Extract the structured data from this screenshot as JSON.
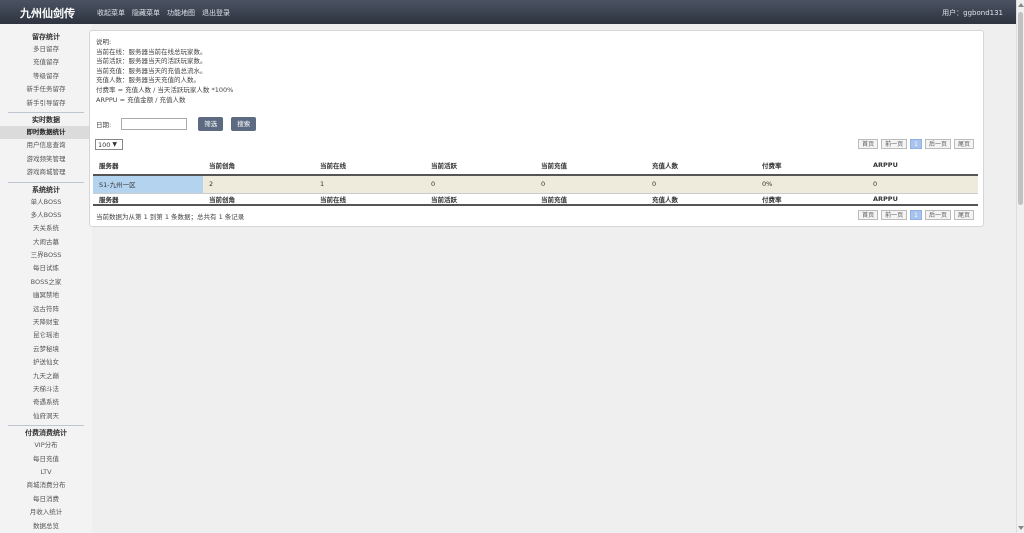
{
  "header": {
    "brand": "九州仙剑传",
    "nav": [
      "收起菜单",
      "隐藏菜单",
      "功能地图",
      "退出登录"
    ],
    "user": "用户：ggbond131"
  },
  "sidebar": {
    "group_retention": "留存统计",
    "retention_items": [
      "多日留存",
      "充值留存",
      "等级留存",
      "新手任务留存",
      "新手引导留存"
    ],
    "group_realtime": "实时数据",
    "realtime_items": [
      "即时数据统计",
      "用户信息查询",
      "游戏频笑管理",
      "游戏商城管理"
    ],
    "group_system": "系统统计",
    "system_items": [
      "单人BOSS",
      "多人BOSS",
      "天关系统",
      "大闹古墓",
      "三界BOSS",
      "每日试炼",
      "BOSS之家",
      "幽冥禁地",
      "远古符阵",
      "天降财宝",
      "昆仑瑶池",
      "云梦秘境",
      "护送仙女",
      "九天之巅",
      "天梯斗法",
      "奇遇系统",
      "仙府洞天"
    ],
    "group_pay": "付费消费统计",
    "pay_items": [
      "VIP分布",
      "每日充值",
      "LTV",
      "商城消费分布",
      "每日消费",
      "月收入统计",
      "数据总览"
    ]
  },
  "description": {
    "title": "说明:",
    "lines": [
      "当前在线：服务器当前在线总玩家数。",
      "当前活跃：服务器当天的活跃玩家数。",
      "当前充值：服务器当天的充值总流水。",
      "充值人数：服务器当天充值的人数。",
      "付费率 = 充值人数 / 当天活跃玩家人数 *100%",
      "ARPPU = 充值金额 / 充值人数"
    ]
  },
  "filter": {
    "date_label": "日期:",
    "date_value": "",
    "filter_button": "筛选",
    "search_button": "搜索"
  },
  "page_size": "100",
  "pager": {
    "first": "首页",
    "prev": "前一页",
    "current": "1",
    "next": "后一页",
    "last": "尾页"
  },
  "table": {
    "headers": [
      "服务器",
      "当前创角",
      "当前在线",
      "当前活跃",
      "当前充值",
      "充值人数",
      "付费率",
      "ARPPU"
    ],
    "rows": [
      [
        "S1-九州一区",
        "2",
        "1",
        "0",
        "0",
        "0",
        "0%",
        "0"
      ]
    ]
  },
  "summary": "当前数据为从第 1 到第 1 条数据；总共有 1 条记录",
  "colors": {
    "topbar": "#3a414e",
    "button": "#5c6b82",
    "row_bg": "#eeeadc",
    "selected_cell": "#b4d3ef",
    "pager_current": "#a7c3ee"
  }
}
